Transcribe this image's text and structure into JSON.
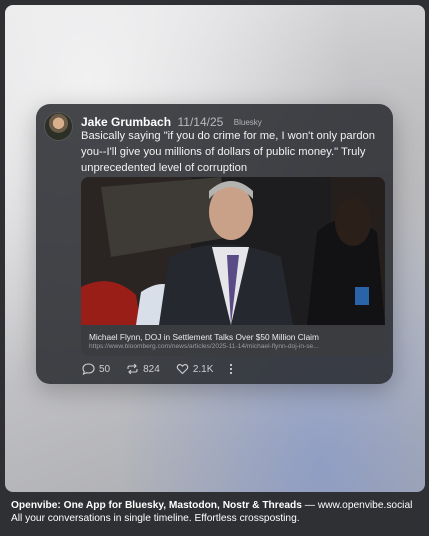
{
  "post": {
    "author": "Jake Grumbach",
    "date": "11/14/25",
    "network": "Bluesky",
    "text": "Basically saying \"if you do crime for me, I won't only pardon you--I'll give you millions of dollars of public money.\" Truly unprecedented level of corruption",
    "link": {
      "title": "Michael Flynn, DOJ in Settlement Talks Over $50 Million Claim",
      "url": "https://www.bloomberg.com/news/articles/2025-11-14/michael-flynn-doj-in-se..."
    },
    "actions": {
      "replies": "50",
      "reposts": "824",
      "likes": "2.1K"
    },
    "icons": {
      "reply": "reply-icon",
      "repost": "repost-icon",
      "like": "heart-icon",
      "more": "more-options-icon"
    }
  },
  "footer": {
    "brand": "Openvibe: One App for Bluesky, Mastodon, Nostr & Threads",
    "separator": " — ",
    "site": "www.openvibe.social",
    "tagline": "All your conversations in single timeline. Effortless crossposting."
  }
}
